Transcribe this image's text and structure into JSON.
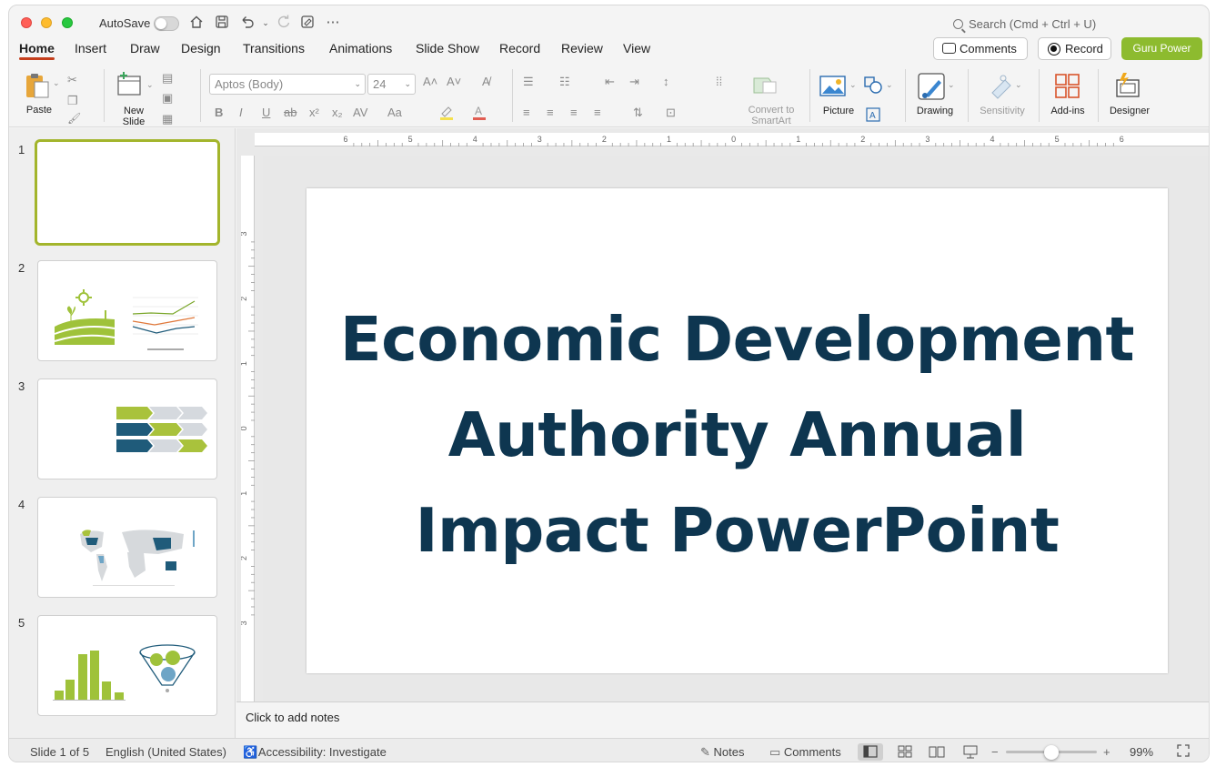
{
  "titlebar": {
    "autosave_label": "AutoSave",
    "search_placeholder": "Search (Cmd + Ctrl + U)"
  },
  "tabs": [
    {
      "label": "Home",
      "active": true
    },
    {
      "label": "Insert"
    },
    {
      "label": "Draw"
    },
    {
      "label": "Design"
    },
    {
      "label": "Transitions"
    },
    {
      "label": "Animations"
    },
    {
      "label": "Slide Show"
    },
    {
      "label": "Record"
    },
    {
      "label": "Review"
    },
    {
      "label": "View"
    }
  ],
  "actions": {
    "comments_label": "Comments",
    "record_label": "Record",
    "guru_label": "Guru Power",
    "guru_color": "#8dbb2f"
  },
  "ribbon": {
    "paste_label": "Paste",
    "new_slide_label_1": "New",
    "new_slide_label_2": "Slide",
    "font_name": "Aptos (Body)",
    "font_size": "24",
    "convert_label_1": "Convert to",
    "convert_label_2": "SmartArt",
    "picture_label": "Picture",
    "drawing_label": "Drawing",
    "sensitivity_label": "Sensitivity",
    "addins_label": "Add-ins",
    "designer_label": "Designer"
  },
  "slides": [
    {
      "number": "1"
    },
    {
      "number": "2"
    },
    {
      "number": "3"
    },
    {
      "number": "4"
    },
    {
      "number": "5"
    }
  ],
  "ruler": {
    "top_ticks": [
      "6",
      "5",
      "4",
      "3",
      "2",
      "1",
      "0",
      "1",
      "2",
      "3",
      "4",
      "5",
      "6"
    ],
    "left_ticks": [
      "3",
      "2",
      "1",
      "0",
      "1",
      "2",
      "3"
    ]
  },
  "slide": {
    "title_line1": "Economic Development",
    "title_line2": "Authority Annual",
    "title_line3": "Impact PowerPoint",
    "title_color": "#0e3650"
  },
  "notes_placeholder": "Click to add notes",
  "status": {
    "slide_position": "Slide 1 of 5",
    "language": "English (United States)",
    "accessibility": "Accessibility: Investigate",
    "notes_label": "Notes",
    "comments_label": "Comments",
    "zoom": "99%"
  }
}
